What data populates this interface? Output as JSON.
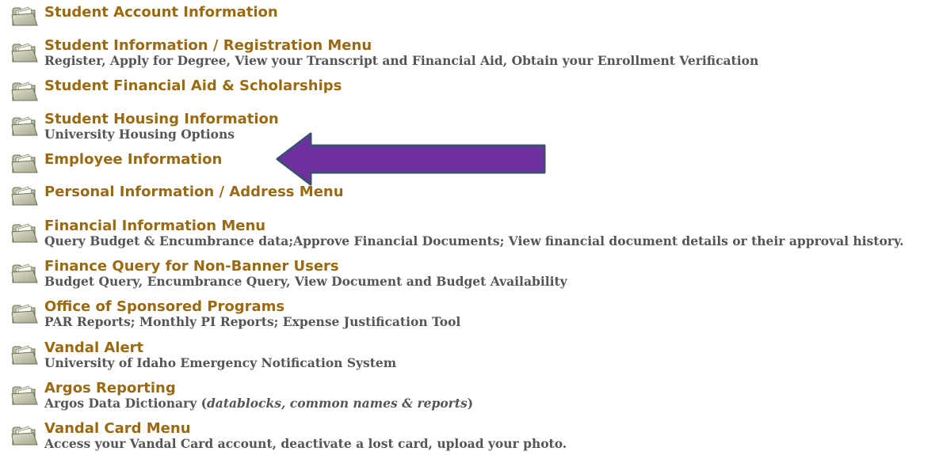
{
  "menu": {
    "items": [
      {
        "title": "Student Account Information",
        "desc": ""
      },
      {
        "title": "Student Information / Registration Menu",
        "desc": "Register, Apply for Degree, View your Transcript and Financial Aid, Obtain your Enrollment Verification"
      },
      {
        "title": "Student Financial Aid & Scholarships",
        "desc": ""
      },
      {
        "title": "Student Housing Information",
        "desc": "University Housing Options"
      },
      {
        "title": "Employee Information",
        "desc": ""
      },
      {
        "title": "Personal Information / Address Menu",
        "desc": ""
      },
      {
        "title": "Financial Information Menu",
        "desc": "Query Budget & Encumbrance data;Approve Financial Documents; View financial document details or their approval history."
      },
      {
        "title": "Finance Query for Non-Banner Users",
        "desc": "Budget Query, Encumbrance Query, View Document and Budget Availability"
      },
      {
        "title": "Office of Sponsored Programs",
        "desc": "PAR Reports; Monthly PI Reports; Expense Justification Tool"
      },
      {
        "title": "Vandal Alert",
        "desc": "University of Idaho Emergency Notification System"
      },
      {
        "title": "Argos Reporting",
        "desc_pre": "Argos Data Dictionary (",
        "desc_italic": "datablocks, common names & reports",
        "desc_post": ")"
      },
      {
        "title": "Vandal Card Menu",
        "desc": "Access your Vandal Card account, deactivate a lost card, upload your photo."
      }
    ]
  },
  "annotation": {
    "arrow_color": "#7030a0",
    "arrow_outline": "#3c4f73",
    "points_to": "Employee Information"
  },
  "colors": {
    "link": "#9a6a12",
    "description": "#555555"
  },
  "icons": {
    "folder": "folder-icon"
  }
}
